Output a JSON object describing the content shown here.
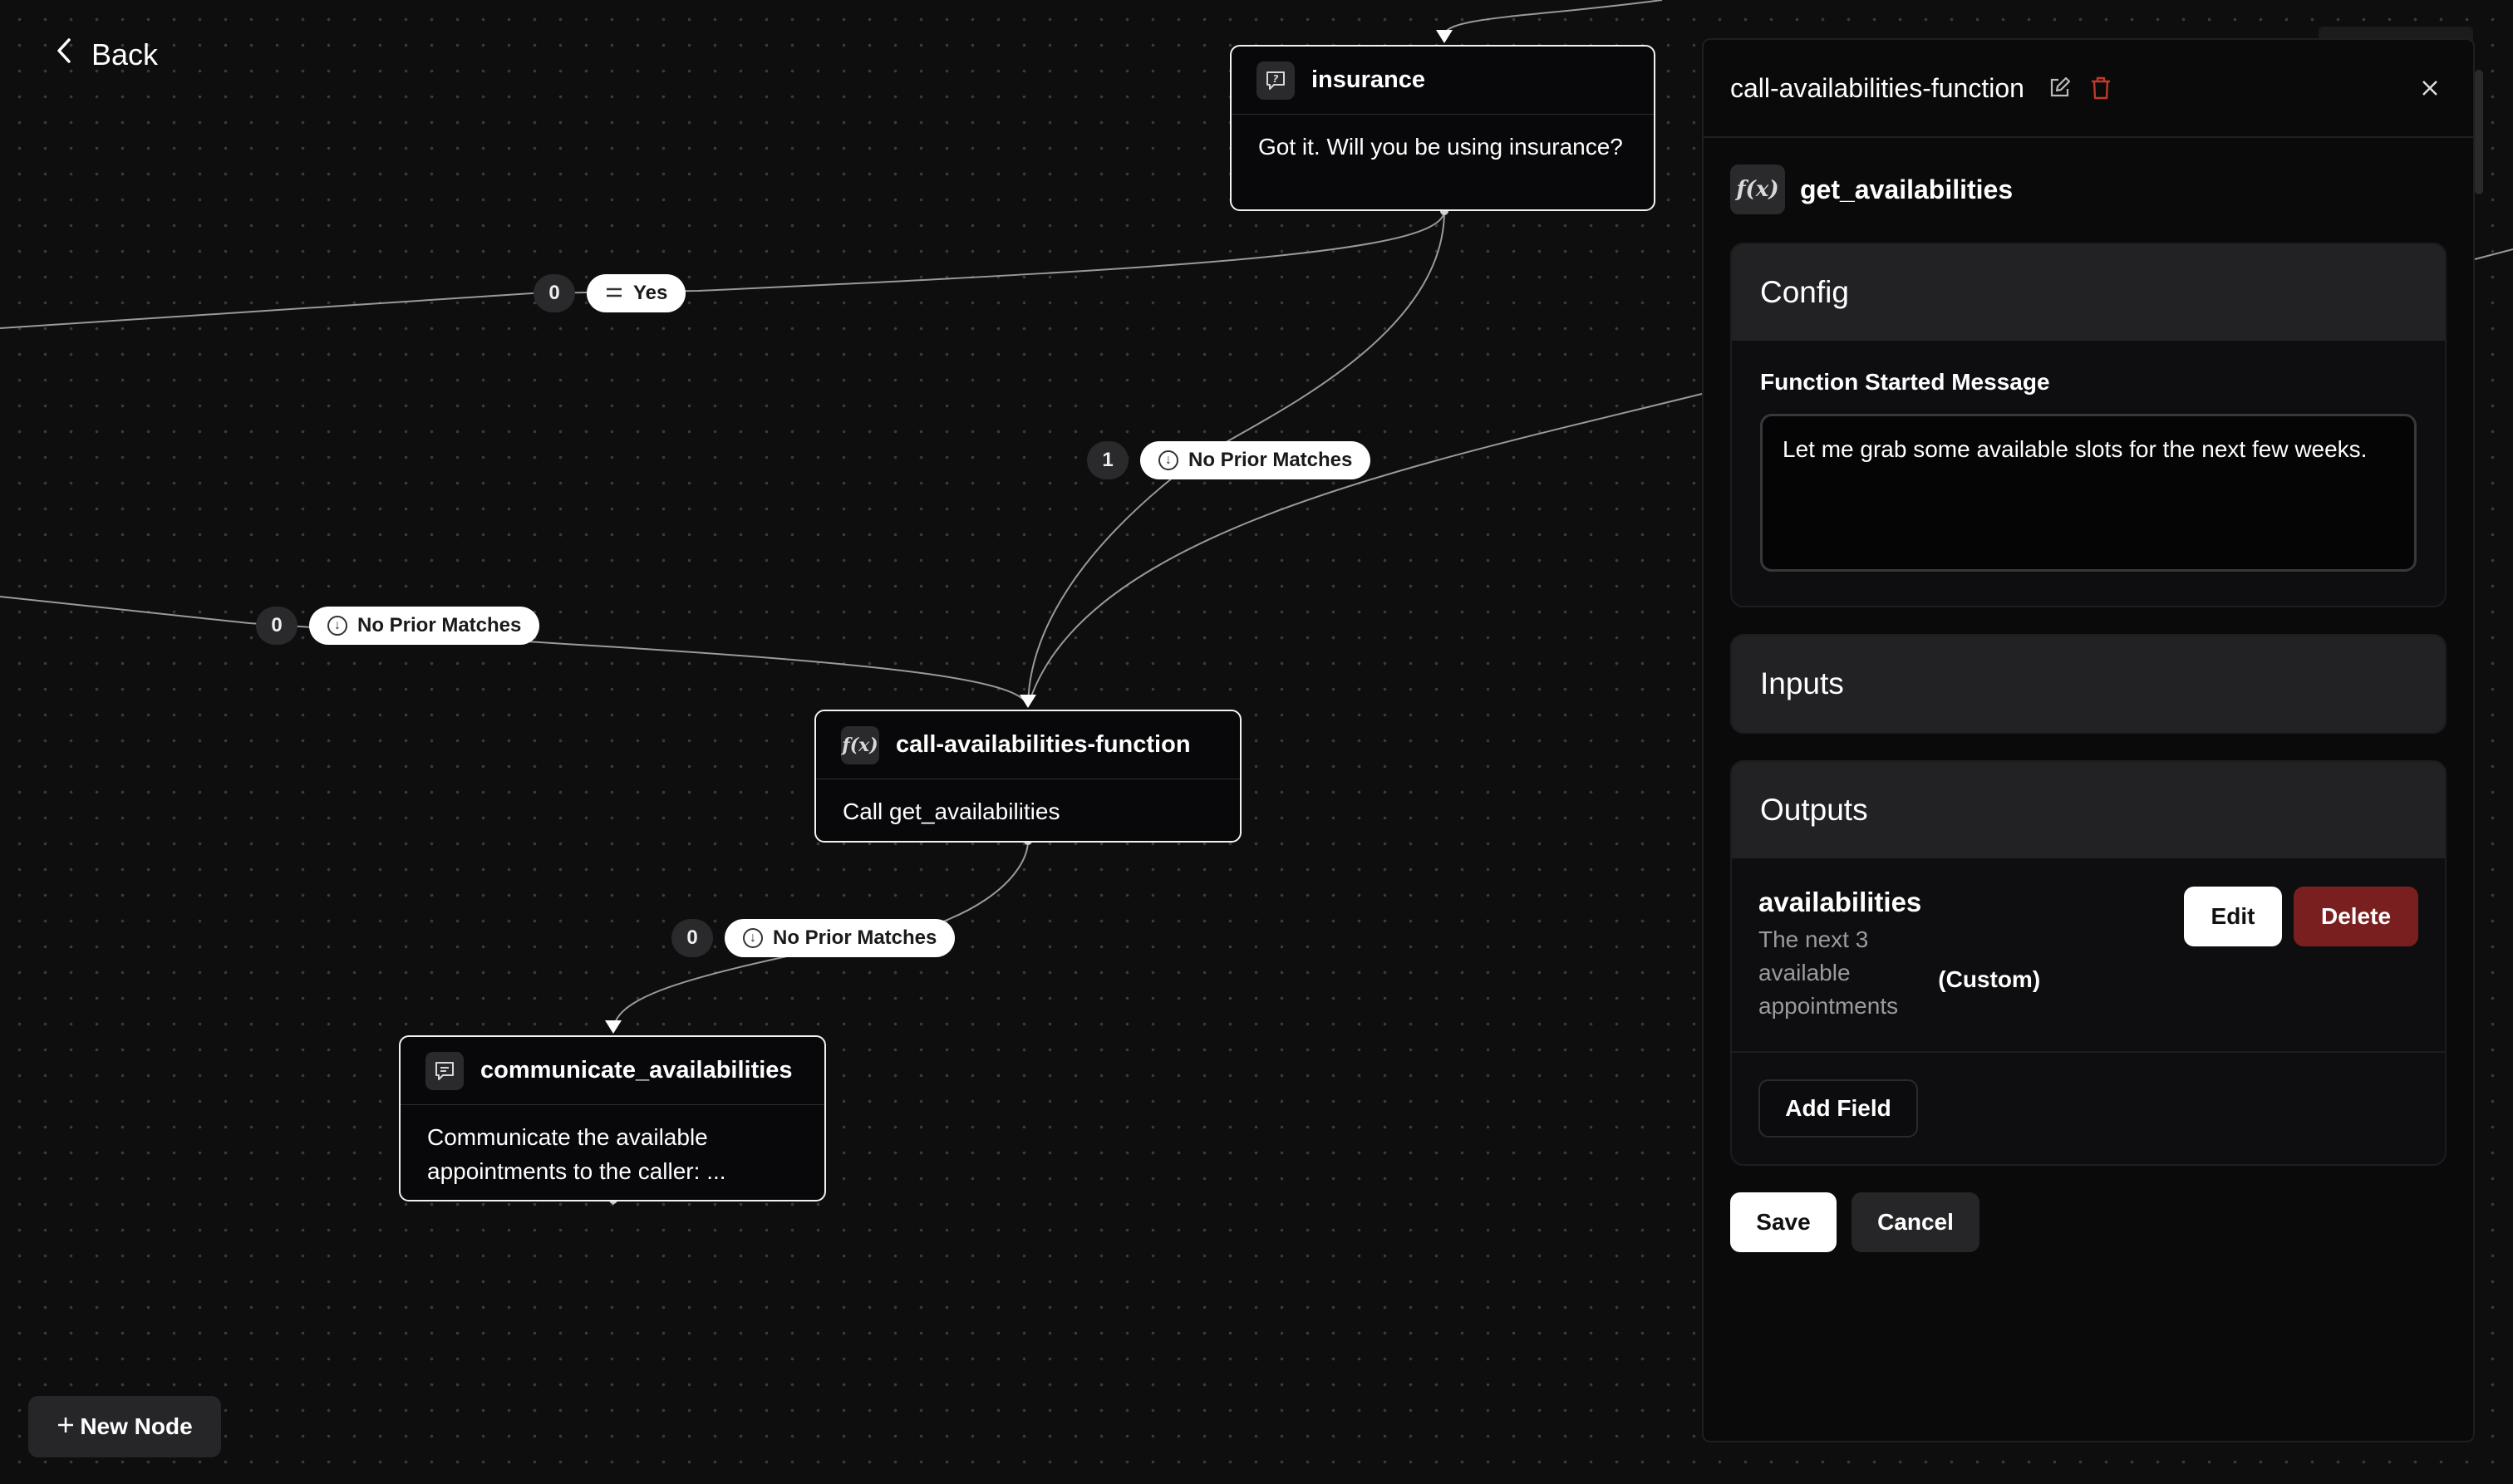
{
  "nav": {
    "back_label": "Back"
  },
  "canvas": {
    "nodes": {
      "insurance": {
        "title": "insurance",
        "body": "Got it. Will you be using insurance?"
      },
      "call_availabilities": {
        "title": "call-availabilities-function",
        "body": "Call get_availabilities"
      },
      "communicate": {
        "title": "communicate_availabilities",
        "body": "Communicate the available appointments to the caller: ..."
      }
    },
    "edges": [
      {
        "count": "0",
        "label": "Yes"
      },
      {
        "count": "1",
        "label": "No Prior Matches"
      },
      {
        "count": "0",
        "label": "No Prior Matches"
      },
      {
        "count": "0",
        "label": "No Prior Matches"
      }
    ],
    "new_node_label": "New Node"
  },
  "panel": {
    "title": "call-availabilities-function",
    "function_name": "get_availabilities",
    "config": {
      "heading": "Config",
      "field_label": "Function Started Message",
      "field_value": "Let me grab some available slots for the next few weeks."
    },
    "inputs": {
      "heading": "Inputs"
    },
    "outputs": {
      "heading": "Outputs",
      "items": [
        {
          "name": "availabilities",
          "description": "The next 3 available appointments",
          "type": "(Custom)",
          "edit_label": "Edit",
          "delete_label": "Delete"
        }
      ],
      "add_field_label": "Add Field"
    },
    "save_label": "Save",
    "cancel_label": "Cancel"
  },
  "colors": {
    "background": "#0e0e0f",
    "accent_red": "#7a1f1f",
    "node_border": "#f2f2f2"
  },
  "icons": [
    "chevron-left-icon",
    "question-bubble-icon",
    "function-icon",
    "chat-bubble-icon",
    "equals-icon",
    "circle-arrow-down-icon",
    "edit-icon",
    "trash-icon",
    "close-icon",
    "plus-icon"
  ]
}
